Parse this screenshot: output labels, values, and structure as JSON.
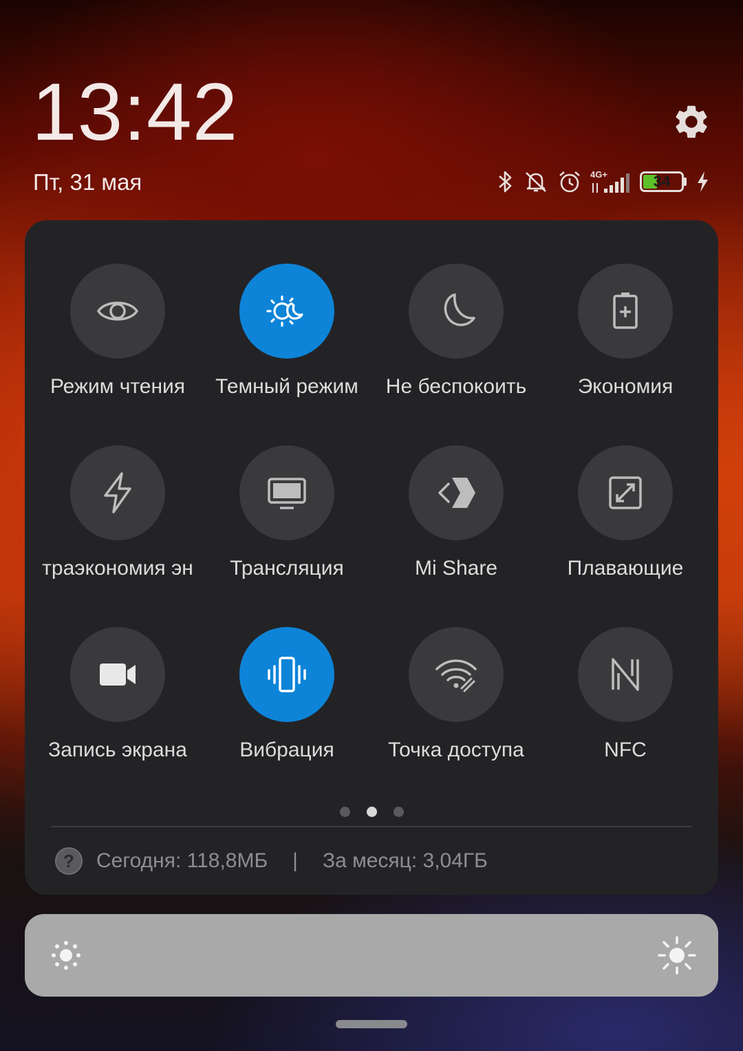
{
  "header": {
    "time": "13:42",
    "date": "Пт, 31 мая"
  },
  "status_bar": {
    "icons": [
      "bluetooth-icon",
      "ringer-off-icon",
      "alarm-icon",
      "signal-4g-icon",
      "battery-icon",
      "charging-icon"
    ],
    "network": "4G+",
    "battery_level": "34"
  },
  "quick_settings": {
    "tiles": [
      {
        "label": "Режим чтения",
        "icon": "eye-icon",
        "active": false
      },
      {
        "label": "Темный режим",
        "icon": "dark-mode-icon",
        "active": true
      },
      {
        "label": "Не беспокоить",
        "icon": "moon-icon",
        "active": false
      },
      {
        "label": "Экономия",
        "icon": "battery-saver-icon",
        "active": false
      },
      {
        "label": "траэкономия эн",
        "icon": "lightning-icon",
        "active": false
      },
      {
        "label": "Трансляция",
        "icon": "monitor-icon",
        "active": false
      },
      {
        "label": "Mi Share",
        "icon": "mi-share-icon",
        "active": false
      },
      {
        "label": "Плавающие",
        "icon": "floating-window-icon",
        "active": false
      },
      {
        "label": "Запись экрана",
        "icon": "video-camera-icon",
        "active": false
      },
      {
        "label": "Вибрация",
        "icon": "vibrate-icon",
        "active": true
      },
      {
        "label": "Точка доступа",
        "icon": "hotspot-icon",
        "active": false
      },
      {
        "label": "NFC",
        "icon": "nfc-icon",
        "active": false
      }
    ],
    "page_count": 3,
    "current_page": 2
  },
  "data_usage": {
    "today": "Сегодня: 118,8МБ",
    "separator": "|",
    "month": "За месяц: 3,04ГБ"
  },
  "colors": {
    "active_tile": "#0d84d8",
    "inactive_tile": "#3a3a3d",
    "panel": "#232326"
  }
}
